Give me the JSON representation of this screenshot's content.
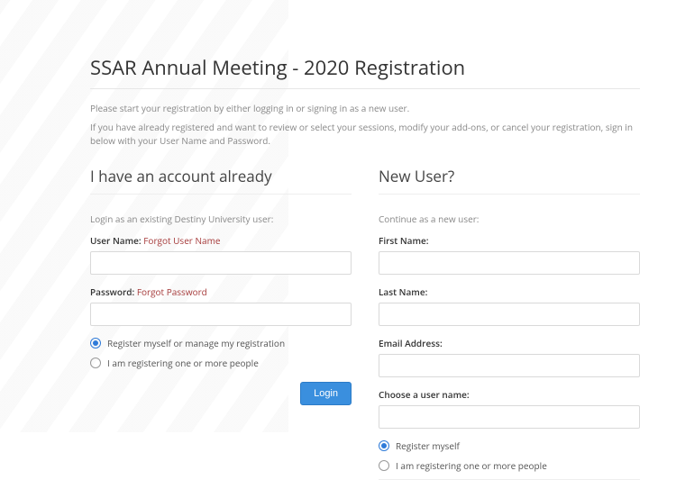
{
  "page": {
    "title": "SSAR Annual Meeting - 2020 Registration",
    "intro1": "Please start your registration by either logging in or signing in as a new user.",
    "intro2": "If you have already registered and want to review or select your sessions, modify your add-ons, or cancel your registration, sign in below with your User Name and Password."
  },
  "existing": {
    "heading": "I have an account already",
    "helper": "Login as an existing Destiny University user:",
    "username_label": "User Name:",
    "forgot_username": "Forgot User Name",
    "password_label": "Password:",
    "forgot_password": "Forgot Password",
    "radio_self": "Register myself or manage my registration",
    "radio_group": "I am registering one or more people",
    "login_button": "Login"
  },
  "newuser": {
    "heading": "New User?",
    "helper": "Continue as a new user:",
    "first_name_label": "First Name:",
    "last_name_label": "Last Name:",
    "email_label": "Email Address:",
    "username_label": "Choose a user name:",
    "radio_self": "Register myself",
    "radio_group": "I am registering one or more people"
  }
}
